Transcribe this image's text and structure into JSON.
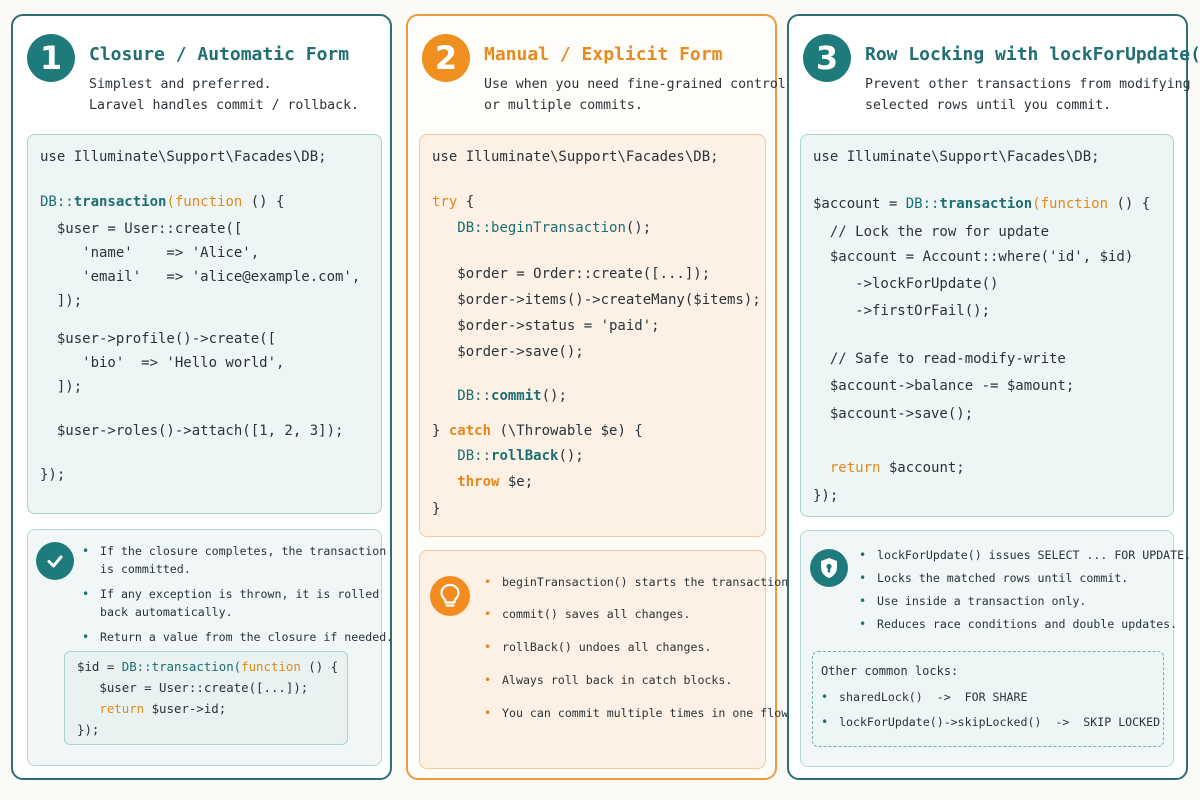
{
  "colors": {
    "teal": "#1f6f73",
    "orange": "#e88b1e",
    "code_bg_teal": "#eef6f5",
    "code_bg_orange": "#fdf1e5"
  },
  "panel1": {
    "number": "1",
    "title": "Closure / Automatic Form",
    "subtitle": "Simplest and preferred.\nLaravel handles commit / rollback.",
    "code": {
      "l1": "use Illuminate\\Support\\Facades\\DB;",
      "l2a": "DB::",
      "l2b": "transaction",
      "l2c": "(",
      "l2d": "function",
      "l2e": " () {",
      "l3": "  $user = User::create([",
      "l4": "     'name'    => 'Alice',",
      "l5": "     'email'   => 'alice@example.com',",
      "l6": "  ]);",
      "l7": "  $user->profile()->create([",
      "l8": "     'bio'  => 'Hello world',",
      "l9": "  ]);",
      "l10": "  $user->roles()->attach([1, 2, 3]);",
      "l11": "});"
    },
    "icon": "check-circle-icon",
    "bullets": [
      "If the closure completes, the transaction\nis committed.",
      "If any exception is thrown, it is rolled\nback automatically.",
      "Return a value from the closure if needed."
    ],
    "subcode": {
      "s1a": "$id = ",
      "s1b": "DB::transaction(",
      "s1c": "function",
      "s1d": " () {",
      "s2": "   $user = User::create([...]);",
      "s3a": "   return",
      "s3b": " $user->id;",
      "s4": "});"
    }
  },
  "panel2": {
    "number": "2",
    "title": "Manual / Explicit Form",
    "subtitle": "Use when you need fine-grained control\nor multiple commits.",
    "code": {
      "l1": "use Illuminate\\Support\\Facades\\DB;",
      "l2": "try",
      "l2b": " {",
      "l3a": "   DB::",
      "l3b": "beginTransaction",
      "l3c": "();",
      "l4": "   $order = Order::create([...]);",
      "l5": "   $order->items()->createMany($items);",
      "l6": "   $order->status = 'paid';",
      "l7": "   $order->save();",
      "l8a": "   DB::",
      "l8b": "commit",
      "l8c": "();",
      "l9a": "} ",
      "l9b": "catch",
      "l9c": " (\\Throwable $e) {",
      "l10a": "   DB::",
      "l10b": "rollBack",
      "l10c": "();",
      "l11a": "   throw",
      "l11b": " $e;",
      "l12": "}"
    },
    "icon": "lightbulb-icon",
    "bullets": [
      "beginTransaction() starts the transaction.",
      "commit() saves all changes.",
      "rollBack() undoes all changes.",
      "Always roll back in catch blocks.",
      "You can commit multiple times in one flow."
    ]
  },
  "panel3": {
    "number": "3",
    "title": "Row Locking with lockForUpdate()",
    "subtitle": "Prevent other transactions from modifying\nselected rows until you commit.",
    "code": {
      "l1": "use Illuminate\\Support\\Facades\\DB;",
      "l2a": "$account = ",
      "l2b": "DB::",
      "l2c": "transaction",
      "l2d": "(",
      "l2e": "function",
      "l2f": " () {",
      "l3": "  // Lock the row for update",
      "l4": "  $account = Account::where('id', $id)",
      "l5": "     ->lockForUpdate()",
      "l6": "     ->firstOrFail();",
      "l7": "  // Safe to read-modify-write",
      "l8": "  $account->balance -= $amount;",
      "l9": "  $account->save();",
      "l10a": "  return",
      "l10b": " $account;",
      "l11": "});"
    },
    "icon": "shield-lock-icon",
    "bullets": [
      "lockForUpdate() issues SELECT ... FOR UPDATE.",
      "Locks the matched rows until commit.",
      "Use inside a transaction only.",
      "Reduces race conditions and double updates."
    ],
    "locks": {
      "heading": "Other common locks:",
      "items": [
        "sharedLock()  ->  FOR SHARE",
        "lockForUpdate()->skipLocked()  ->  SKIP LOCKED"
      ]
    }
  }
}
